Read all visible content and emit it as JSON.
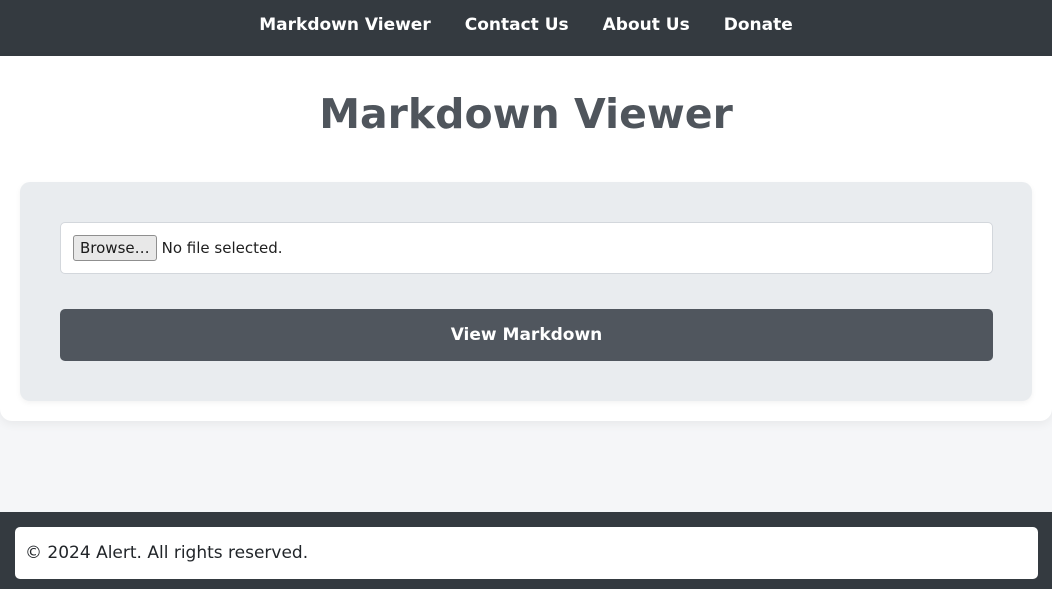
{
  "nav": {
    "items": [
      {
        "label": "Markdown Viewer"
      },
      {
        "label": "Contact Us"
      },
      {
        "label": "About Us"
      },
      {
        "label": "Donate"
      }
    ]
  },
  "main": {
    "title": "Markdown Viewer",
    "file_input": {
      "browse_label": "Browse…",
      "status": "No file selected."
    },
    "submit_label": "View Markdown"
  },
  "footer": {
    "text": "© 2024 Alert. All rights reserved."
  },
  "colors": {
    "navbar_bg": "#343a40",
    "title": "#4f555c",
    "panel_bg": "#e9ecef",
    "button_bg": "#50565e"
  }
}
